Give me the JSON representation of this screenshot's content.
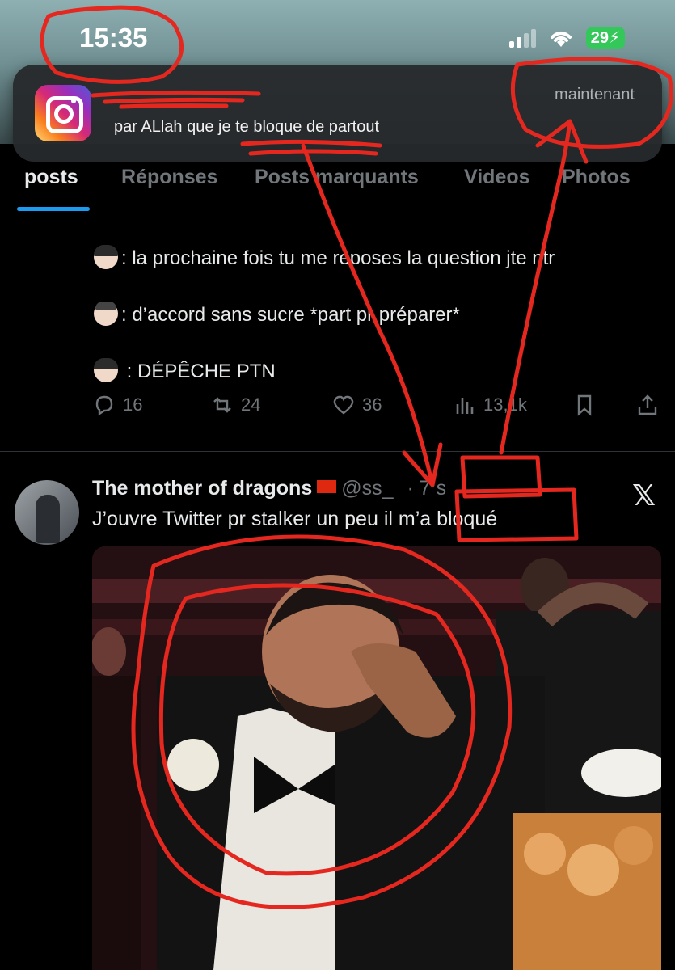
{
  "status_bar": {
    "time": "15:35",
    "battery": "29"
  },
  "notification": {
    "app_icon": "instagram-icon",
    "time": "maintenant",
    "message": "par ALlah que je te bloque de partout"
  },
  "tabs": [
    "posts",
    "Réponses",
    "Posts marquants",
    "Videos",
    "Photos"
  ],
  "post": {
    "lines": [
      ": la prochaine fois tu me reposes la question jte ntr",
      ": d’accord sans sucre *part pr préparer*",
      ": DÉPÊCHE PTN"
    ],
    "replies": "16",
    "reposts": "24",
    "likes": "36",
    "views": "13,1k"
  },
  "tweet": {
    "author": "The mother of dragons",
    "handle": "@ss_",
    "time": "· 7 s",
    "text": "J’ouvre Twitter pr stalker un peu il m’a bloqué"
  },
  "colors": {
    "accent": "#1d9bf0",
    "annotation": "#e5281f",
    "battery": "#34c759"
  }
}
